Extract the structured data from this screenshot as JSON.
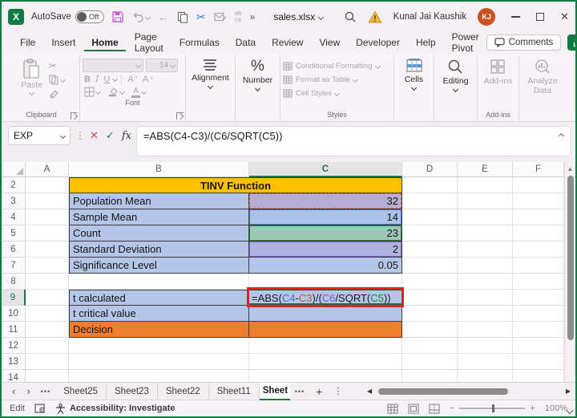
{
  "titlebar": {
    "autosave_label": "AutoSave",
    "autosave_state": "Off",
    "overflow": "»",
    "filename": "sales.xlsx",
    "user_name": "Kunal Jai Kaushik",
    "user_initials": "KJ"
  },
  "ribbon": {
    "tabs": [
      {
        "label": "File",
        "active": false
      },
      {
        "label": "Insert",
        "active": false
      },
      {
        "label": "Home",
        "active": true
      },
      {
        "label": "Page Layout",
        "active": false
      },
      {
        "label": "Formulas",
        "active": false
      },
      {
        "label": "Data",
        "active": false
      },
      {
        "label": "Review",
        "active": false
      },
      {
        "label": "View",
        "active": false
      },
      {
        "label": "Developer",
        "active": false
      },
      {
        "label": "Help",
        "active": false
      },
      {
        "label": "Power Pivot",
        "active": false
      }
    ],
    "comments_label": "Comments",
    "groups": {
      "clipboard": {
        "label": "Clipboard",
        "paste_label": "Paste"
      },
      "font": {
        "label": "Font",
        "size_value": "14"
      },
      "alignment": {
        "label": "Alignment"
      },
      "number": {
        "label": "Number"
      },
      "styles": {
        "label": "Styles",
        "items": [
          "Conditional Formatting",
          "Format as Table",
          "Cell Styles"
        ]
      },
      "cells": {
        "label": "Cells"
      },
      "editing": {
        "label": "Editing"
      },
      "addins": {
        "label": "Add-ins",
        "button_label": "Add-ins"
      },
      "analyze": {
        "line1": "Analyze",
        "line2": "Data"
      }
    }
  },
  "formula_bar": {
    "name_box": "EXP",
    "fx_label": "fx",
    "formula": "=ABS(C4-C3)/(C6/SQRT(C5))"
  },
  "grid": {
    "columns": [
      "A",
      "B",
      "C",
      "D",
      "E",
      "F"
    ],
    "selected_column": "C",
    "selected_row": "9",
    "title_row": {
      "n": "2",
      "text": "TINV Function"
    },
    "rows": [
      {
        "n": "3",
        "label": "Population Mean",
        "value": "32",
        "fill": "#B5ADD2",
        "ref_color": "#C75B5B",
        "ref_style": "dashed"
      },
      {
        "n": "4",
        "label": "Sample Mean",
        "value": "14",
        "fill": "#ADC2E9",
        "ref_color": "#4472C4",
        "ref_style": "solid"
      },
      {
        "n": "5",
        "label": "Count",
        "value": "23",
        "fill": "#A1C6B7",
        "ref_color": "#1E8243",
        "ref_style": "solid"
      },
      {
        "n": "6",
        "label": "Standard Deviation",
        "value": "2",
        "fill": "#AFB3DE",
        "ref_color": "#7B5FC5",
        "ref_style": "solid"
      },
      {
        "n": "7",
        "label": "Significance Level",
        "value": "0.05",
        "fill": "#B4C6E7"
      },
      {
        "n": "9",
        "label": "t calculated",
        "formula": true,
        "fill": "#B4C6E7",
        "top": true
      },
      {
        "n": "10",
        "label": "t critical value",
        "value": "",
        "fill": "#B4C6E7"
      },
      {
        "n": "11",
        "label": "Decision",
        "value": "",
        "fill": "#ED7D31",
        "label_fill": "#ED7D31"
      }
    ],
    "formula_segments": [
      {
        "text": "=ABS(",
        "color": "ink"
      },
      {
        "text": "C4",
        "color": "blue"
      },
      {
        "text": "-",
        "color": "ink"
      },
      {
        "text": "C3",
        "color": "red"
      },
      {
        "text": ")/(",
        "color": "ink"
      },
      {
        "text": "C6",
        "color": "purple"
      },
      {
        "text": "/SQRT(",
        "color": "ink"
      },
      {
        "text": "C5",
        "color": "green"
      },
      {
        "text": "))",
        "color": "ink"
      }
    ]
  },
  "sheet_bar": {
    "sheets": [
      "Sheet25",
      "Sheet23",
      "Sheet22",
      "Sheet11"
    ],
    "active_sheet": "Sheet"
  },
  "status_bar": {
    "mode": "Edit",
    "accessibility": "Accessibility: Investigate",
    "zoom": "100%"
  },
  "colors": {
    "excel_green": "#107C41",
    "accent_green_dark": "#1E7145",
    "gold": "#FFC000",
    "band_blue": "#B4C6E7",
    "orange": "#ED7D31",
    "annotation_red": "#DE241C",
    "avatar_orange": "#C8531E",
    "save_purple": "#BC63CE",
    "cut_blue": "#2B7CD3",
    "warning_yellow": "#F2B63C",
    "formula_colors": {
      "ink": "#1A1A1A",
      "blue": "#4472C4",
      "red": "#C0504D",
      "purple": "#7B5FC5",
      "green": "#1E8243"
    }
  }
}
